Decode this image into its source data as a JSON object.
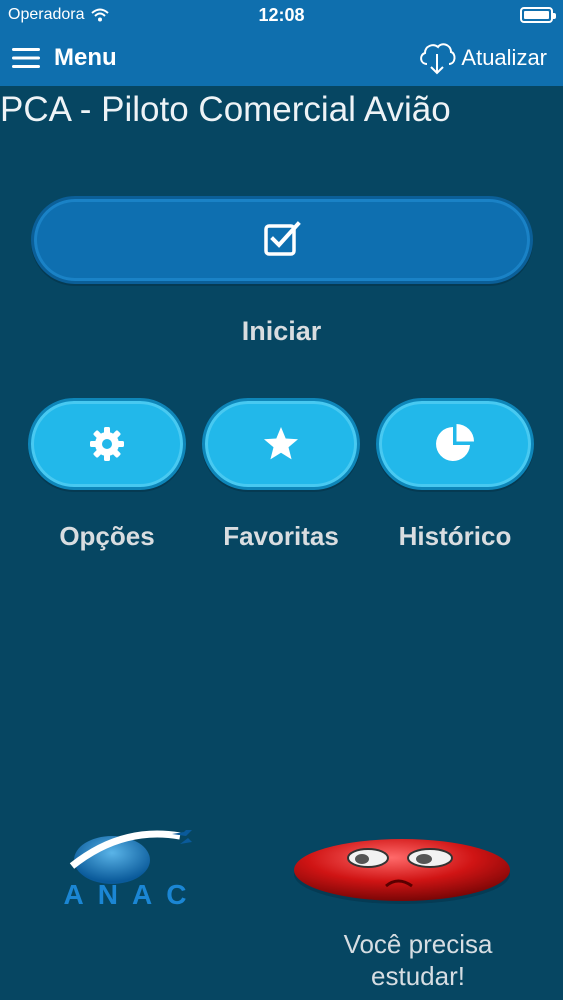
{
  "status_bar": {
    "carrier": "Operadora",
    "time": "12:08"
  },
  "nav": {
    "menu_label": "Menu",
    "refresh_label": "Atualizar"
  },
  "page_title": "PCA - Piloto Comercial Avião",
  "start_button": {
    "label": "Iniciar",
    "icon": "checkbox-icon"
  },
  "actions": [
    {
      "label": "Opções",
      "icon": "gear-icon"
    },
    {
      "label": "Favoritas",
      "icon": "star-icon"
    },
    {
      "label": "Histórico",
      "icon": "pie-chart-icon"
    }
  ],
  "footer": {
    "logo_text": "ANAC",
    "mood_message": "Você precisa estudar!"
  },
  "colors": {
    "background": "#064662",
    "nav_bar": "#0f6fae",
    "start_button": "#0e6fb0",
    "action_buttons": "#22b8ea",
    "mood_face": "#d01414"
  }
}
